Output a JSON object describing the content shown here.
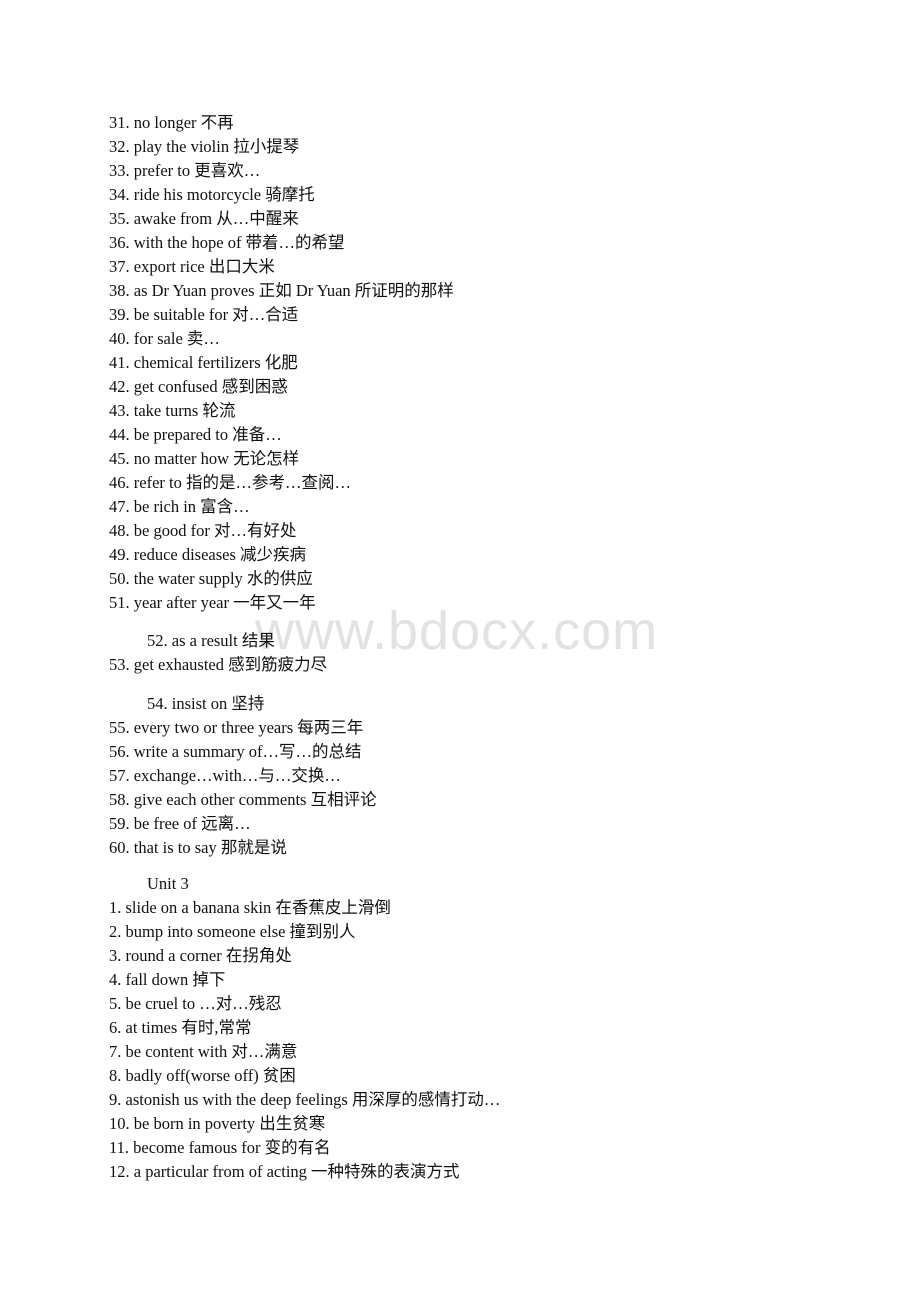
{
  "watermark": "www.bdocx.com",
  "list_a": [
    "31. no longer 不再",
    "32. play the violin 拉小提琴",
    "33. prefer to 更喜欢…",
    "34. ride his motorcycle 骑摩托",
    "35. awake from 从…中醒来",
    "36. with the hope of 带着…的希望",
    "37. export rice 出口大米",
    "38. as Dr Yuan proves 正如 Dr Yuan 所证明的那样",
    "39. be suitable for 对…合适",
    "40. for sale  卖…",
    "41. chemical fertilizers 化肥",
    "42. get confused 感到困惑",
    "43. take turns 轮流",
    "44. be prepared to 准备…",
    "45. no matter how 无论怎样",
    "46. refer to 指的是…参考…查阅…",
    "47. be rich in 富含…",
    "48. be good for 对…有好处",
    "49. reduce diseases 减少疾病",
    "50. the water supply 水的供应",
    "51. year after year 一年又一年"
  ],
  "item_52": "52. as a result 结果",
  "item_53": "53. get exhausted 感到筋疲力尽",
  "item_54": "54.  insist on 坚持",
  "list_b": [
    "55. every two or three years 每两三年",
    "56. write a summary of…写…的总结",
    "57. exchange…with…与…交换…",
    "58. give each other comments 互相评论",
    "59. be free of 远离…",
    "60. that is to say 那就是说"
  ],
  "unit_heading": "Unit 3",
  "unit3_items": [
    "1. slide on a banana skin 在香蕉皮上滑倒",
    "2. bump into someone else 撞到别人",
    "3. round a corner 在拐角处",
    "4. fall down 掉下",
    "5. be cruel to …对…残忍",
    "6. at times 有时,常常",
    "7. be content with 对…满意",
    "8. badly off(worse off) 贫困",
    "9. astonish us with the deep feelings 用深厚的感情打动…",
    "10. be born in poverty 出生贫寒",
    "11. become famous for 变的有名",
    "12. a particular from of acting 一种特殊的表演方式"
  ]
}
